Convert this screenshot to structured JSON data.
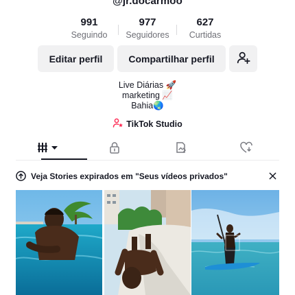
{
  "profile": {
    "username": "@jr.docarmoo",
    "stats": [
      {
        "value": "991",
        "label": "Seguindo"
      },
      {
        "value": "977",
        "label": "Seguidores"
      },
      {
        "value": "627",
        "label": "Curtidas"
      }
    ],
    "buttons": {
      "edit": "Editar perfil",
      "share": "Compartilhar perfil",
      "add_friend_icon": "add-user-icon"
    },
    "bio": [
      "Live Diárias 🚀",
      "marketing 📈",
      "Bahia🌏"
    ],
    "studio_link": "TikTok Studio",
    "studio_icon": "studio-person-icon"
  },
  "tabs": [
    {
      "icon": "grid-videos-icon",
      "active": true
    },
    {
      "icon": "lock-icon",
      "active": false
    },
    {
      "icon": "repost-icon",
      "active": false
    },
    {
      "icon": "liked-heart-icon",
      "active": false
    }
  ],
  "banner": {
    "text": "Veja Stories expirados em \"Seus vídeos privados\"",
    "icon": "upload-circle-icon",
    "close_icon": "close-icon"
  },
  "videos": [
    {
      "scene": "man in swimming pool"
    },
    {
      "scene": "man exercising on pool slide near buildings"
    },
    {
      "scene": "stand up paddle on sea"
    }
  ],
  "colors": {
    "text": "#161823",
    "secondary": "#6e6f76",
    "button_bg": "#f1f1f2",
    "accent": "#fe2c55"
  }
}
